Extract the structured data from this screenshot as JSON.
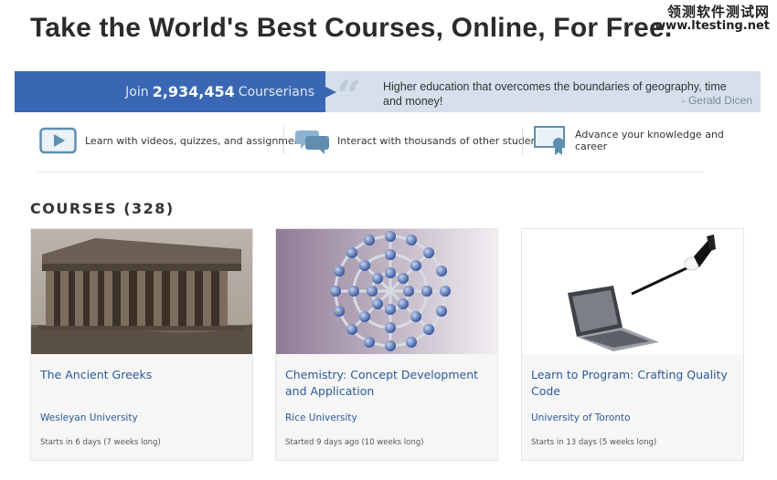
{
  "watermark": {
    "line1": "领测软件测试网",
    "line2": "www.ltesting.net"
  },
  "headline": "Take the World's Best Courses, Online, For Free.",
  "join": {
    "prefix": "Join",
    "count": "2,934,454",
    "suffix": "Courserians"
  },
  "quote": {
    "text": "Higher education that overcomes the boundaries of geography, time and money!",
    "author": "- Gerald Dicen"
  },
  "features": [
    {
      "icon": "video-icon",
      "label": "Learn with videos, quizzes, and assignments"
    },
    {
      "icon": "chat-bubbles-icon",
      "label": "Interact with thousands of other students"
    },
    {
      "icon": "certificate-icon",
      "label": "Advance your knowledge and career"
    }
  ],
  "courses_heading": "COURSES (328)",
  "courses": [
    {
      "image": "parthenon-photo",
      "title": "The Ancient Greeks",
      "university": "Wesleyan University",
      "dates": "Starts in 6 days (7 weeks long)"
    },
    {
      "image": "buckyball-molecule",
      "title": "Chemistry: Concept Development and Application",
      "university": "Rice University",
      "dates": "Started 9 days ago (10 weeks long)"
    },
    {
      "image": "laptop-with-wand",
      "title": "Learn to Program: Crafting Quality Code",
      "university": "University of Toronto",
      "dates": "Starts in 13 days (5 weeks long)"
    }
  ],
  "colors": {
    "brand_blue": "#3a67b3",
    "quote_bg": "#d5e0ec",
    "link_blue": "#2a5a9a"
  }
}
